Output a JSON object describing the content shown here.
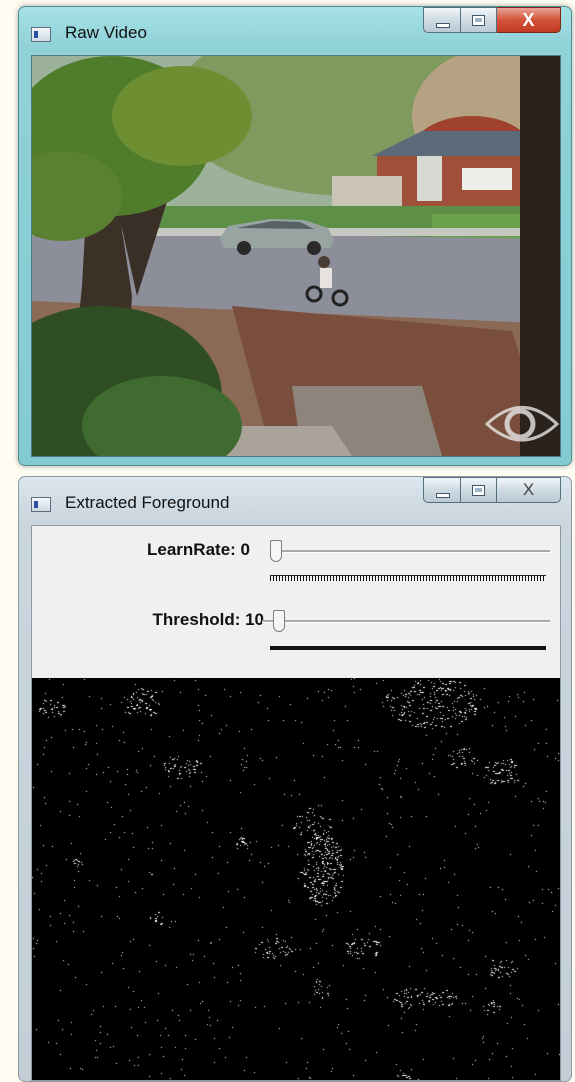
{
  "windows": {
    "raw_video": {
      "title": "Raw Video",
      "buttons": {
        "minimize": "",
        "maximize": "",
        "close": "X"
      }
    },
    "extracted_foreground": {
      "title": "Extracted Foreground",
      "buttons": {
        "minimize": "",
        "maximize": "",
        "close": "X"
      },
      "trackbars": [
        {
          "label": "LearnRate: 0",
          "value": 0,
          "max": 100
        },
        {
          "label": "Threshold: 10",
          "value": 10,
          "max": 255
        }
      ]
    }
  },
  "colors": {
    "raw_window_frame": "#8fd2d8",
    "foreground_window_frame": "#cbd6df",
    "close_button_active": "#d3533a",
    "mask_background": "#000000",
    "mask_pixels": "#ffffff"
  },
  "icons": [
    "app-window-icon",
    "minimize-icon",
    "maximize-icon",
    "close-icon",
    "camera-eye-watermark-icon"
  ]
}
